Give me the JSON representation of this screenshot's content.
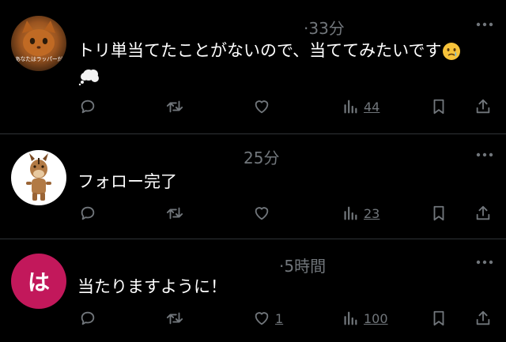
{
  "posts": [
    {
      "avatar_caption": "あなたはラッパーだ",
      "time": "·33分",
      "text": "トリ単当てたことがないので、当ててみたいです",
      "emoji": [
        "crying-face",
        "thought-bubble"
      ],
      "views": "44",
      "likes": ""
    },
    {
      "time": "25分",
      "text": "フォロー完了",
      "views": "23",
      "likes": ""
    },
    {
      "avatar_letter": "は",
      "time": "·5時間",
      "text": "当たりますように！",
      "likes": "1",
      "views": "100"
    }
  ],
  "colors": {
    "background": "#000000",
    "text": "#ffffff",
    "muted": "#71767b",
    "divider": "#2f3336",
    "avatar_letter_bg": "#c2185b"
  }
}
